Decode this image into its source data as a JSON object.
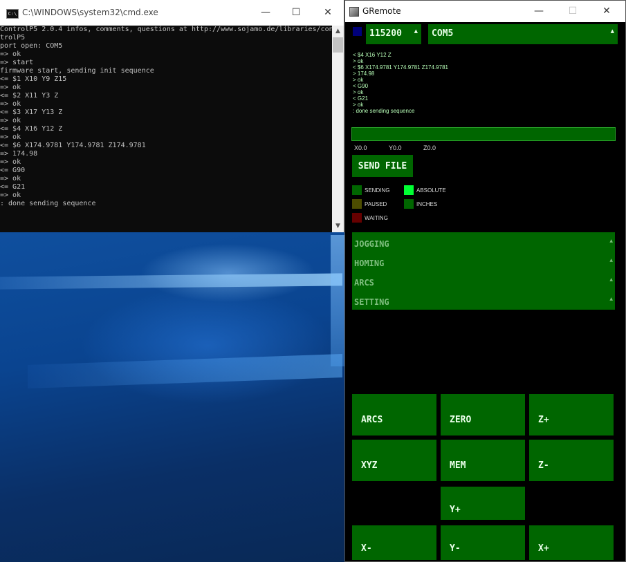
{
  "cmd": {
    "title": "C:\\WINDOWS\\system32\\cmd.exe",
    "icon": "C:\\",
    "lines": [
      "ControlP5 2.0.4 infos, comments, questions at http://www.sojamo.de/libraries/con",
      "trolP5",
      "port open: COM5",
      "=> ok",
      "=> start",
      "firmware start, sending init sequence",
      "<= $1 X10 Y9 Z15",
      "=> ok",
      "<= $2 X11 Y3 Z",
      "=> ok",
      "<= $3 X17 Y13 Z",
      "=> ok",
      "<= $4 X16 Y12 Z",
      "=> ok",
      "<= $6 X174.9781 Y174.9781 Z174.9781",
      "=> 174.98",
      "=> ok",
      "<= G90",
      "=> ok",
      "<= G21",
      "=> ok",
      ": done sending sequence"
    ],
    "buttons": {
      "minimize": "—",
      "maximize": "☐",
      "close": "✕"
    }
  },
  "gremote": {
    "title": "GRemote",
    "buttons": {
      "minimize": "—",
      "maximize": "☐",
      "close": "✕"
    },
    "baud": "115200",
    "port": "COM5",
    "log": [
      "< $4 X16 Y12 Z",
      "> ok",
      "< $6 X174.9781 Y174.9781 Z174.9781",
      "> 174.98",
      "> ok",
      "< G90",
      "> ok",
      "< G21",
      "> ok",
      ": done sending sequence"
    ],
    "coords": {
      "x": "X0.0",
      "y": "Y0.0",
      "z": "Z0.0"
    },
    "send_file": "SEND FILE",
    "indicators": {
      "sending": "SENDING",
      "paused": "PAUSED",
      "waiting": "WAITING",
      "absolute": "ABSOLUTE",
      "inches": "INCHES"
    },
    "accordion": [
      "JOGGING",
      "HOMING",
      "ARCS",
      "SETTING"
    ],
    "pad": {
      "arcs": "ARCS",
      "zero": "ZERO",
      "zplus": "Z+",
      "xyz": "XYZ",
      "mem": "MEM",
      "zminus": "Z-",
      "yplus": "Y+",
      "xminus": "X-",
      "yminus": "Y-",
      "xplus": "X+"
    },
    "colors": {
      "green": "#006600",
      "bright_green": "#00ff33",
      "dark_olive": "#4d4d00",
      "dark_red": "#660000"
    }
  }
}
